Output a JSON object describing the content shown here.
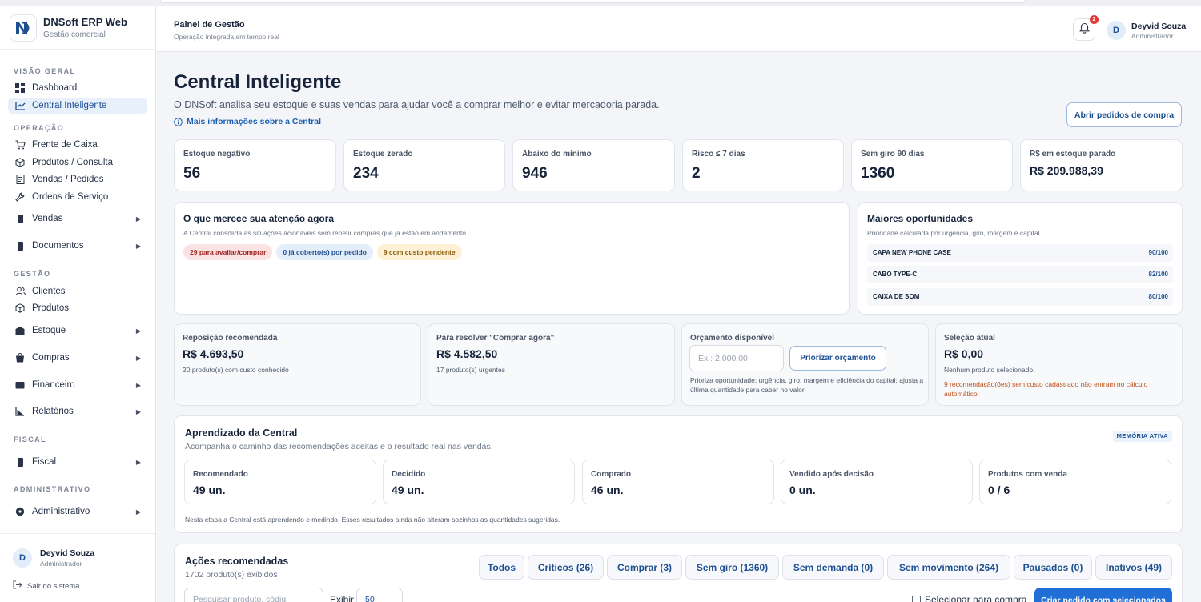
{
  "brand": {
    "title": "DNSoft ERP Web",
    "subtitle": "Gestão comercial"
  },
  "sidebar": {
    "sections": {
      "overview": "VISÃO GERAL",
      "operation": "OPERAÇÃO",
      "management": "GESTÃO",
      "fiscal": "FISCAL",
      "admin": "ADMINISTRATIVO"
    },
    "items": {
      "dashboard": "Dashboard",
      "central": "Central Inteligente",
      "pdv": "Frente de Caixa",
      "produtos_consulta": "Produtos / Consulta",
      "vendas_pedidos": "Vendas / Pedidos",
      "ordens": "Ordens de Serviço",
      "vendas": "Vendas",
      "documentos": "Documentos",
      "clientes": "Clientes",
      "produtos": "Produtos",
      "estoque": "Estoque",
      "compras": "Compras",
      "financeiro": "Financeiro",
      "relatorios": "Relatórios",
      "fiscal": "Fiscal",
      "administrativo": "Administrativo"
    },
    "footer": {
      "initial": "D",
      "name": "Deyvid Souza",
      "role": "Administrador",
      "logout": "Sair do sistema"
    }
  },
  "header": {
    "title": "Painel de Gestão",
    "subtitle": "Operação integrada em tempo real",
    "notifications": "2",
    "user_initial": "D",
    "user_name": "Deyvid Souza",
    "user_role": "Administrador"
  },
  "page": {
    "title": "Central Inteligente",
    "subtitle": "O DNSoft analisa seu estoque e suas vendas para ajudar você a comprar melhor e evitar mercadoria parada.",
    "more_info": "Mais informações sobre a Central",
    "open_orders_button": "Abrir pedidos de compra"
  },
  "kpis": [
    {
      "label": "Estoque negativo",
      "value": "56"
    },
    {
      "label": "Estoque zerado",
      "value": "234"
    },
    {
      "label": "Abaixo do mínimo",
      "value": "946"
    },
    {
      "label": "Risco ≤ 7 dias",
      "value": "2"
    },
    {
      "label": "Sem giro 90 dias",
      "value": "1360"
    },
    {
      "label": "R$ em estoque parado",
      "value": "R$ 209.988,39"
    }
  ],
  "attention": {
    "title": "O que merece sua atenção agora",
    "subtitle": "A Central consolida as situações acionáveis sem repetir compras que já estão em andamento.",
    "pills": [
      "29 para avaliar/comprar",
      "0 já coberto(s) por pedido",
      "9 com custo pendente"
    ]
  },
  "opportunities": {
    "title": "Maiores oportunidades",
    "subtitle": "Prioridade calculada por urgência, giro, margem e capital.",
    "items": [
      {
        "name": "CAPA NEW PHONE CASE",
        "score": "90/100"
      },
      {
        "name": "CABO TYPE-C",
        "score": "82/100"
      },
      {
        "name": "CAIXA DE SOM",
        "score": "80/100"
      }
    ]
  },
  "replenish": {
    "label": "Reposição recomendada",
    "value": "R$ 4.693,50",
    "note": "20 produto(s) com custo conhecido"
  },
  "buy_now": {
    "label": "Para resolver \"Comprar agora\"",
    "value": "R$ 4.582,50",
    "note": "17 produto(s) urgentes"
  },
  "budget": {
    "label": "Orçamento disponível",
    "placeholder": "Ex.: 2.000,00",
    "button": "Priorizar orçamento",
    "note": "Prioriza oportunidade: urgência, giro, margem e eficiência do capital; ajusta a última quantidade para caber no valor."
  },
  "selection": {
    "label": "Seleção atual",
    "value": "R$ 0,00",
    "note": "Nenhum produto selecionado.",
    "warning": "9 recomendação(ões) sem custo cadastrado não entram no cálculo automático."
  },
  "learning": {
    "title": "Aprendizado da Central",
    "subtitle": "Acompanha o caminho das recomendações aceitas e o resultado real nas vendas.",
    "badge": "MEMÓRIA ATIVA",
    "boxes": [
      {
        "label": "Recomendado",
        "value": "49 un."
      },
      {
        "label": "Decidido",
        "value": "49 un."
      },
      {
        "label": "Comprado",
        "value": "46 un."
      },
      {
        "label": "Vendido após decisão",
        "value": "0 un."
      },
      {
        "label": "Produtos com venda",
        "value": "0 / 6"
      }
    ],
    "footnote": "Nesta etapa a Central está aprendendo e medindo. Esses resultados ainda não alteram sozinhos as quantidades sugeridas."
  },
  "actions": {
    "title": "Ações recomendadas",
    "subtitle": "1702 produto(s) exibidos",
    "tabs": [
      "Todos",
      "Críticos (26)",
      "Comprar (3)",
      "Sem giro (1360)",
      "Sem demanda (0)",
      "Sem movimento (264)",
      "Pausados (0)",
      "Inativos (49)"
    ],
    "search_placeholder": "Pesquisar produto, códig",
    "show_label": "Exibir",
    "show_value": "50",
    "select_label": "Selecionar para compra",
    "create_button": "Criar pedido com selecionados"
  },
  "colors": {
    "accent": "#1d4f91",
    "danger": "#e53935",
    "warning_text": "#c0501a"
  }
}
